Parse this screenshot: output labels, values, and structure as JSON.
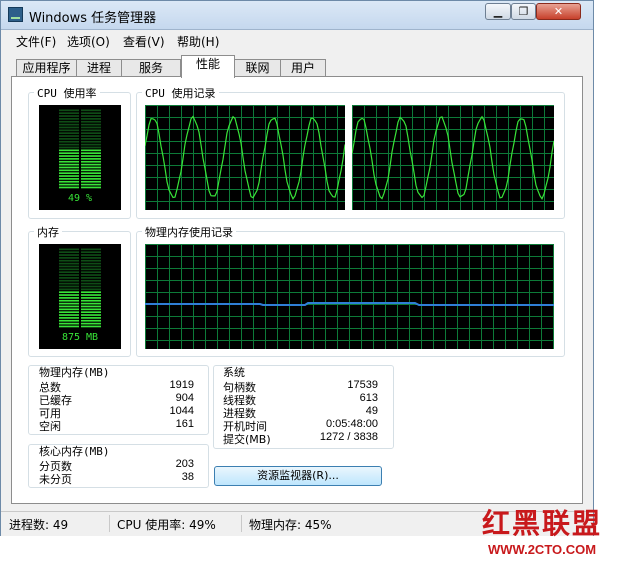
{
  "window": {
    "title": "Windows 任务管理器",
    "min_label": "▁",
    "max_label": "❐",
    "close_label": "✕",
    "icon": "task-manager-icon"
  },
  "menu": [
    {
      "label": "文件(F)"
    },
    {
      "label": "选项(O)"
    },
    {
      "label": "查看(V)"
    },
    {
      "label": "帮助(H)"
    }
  ],
  "tabs": [
    {
      "label": "应用程序"
    },
    {
      "label": "进程"
    },
    {
      "label": "服务"
    },
    {
      "label": "性能",
      "active": true
    },
    {
      "label": "联网"
    },
    {
      "label": "用户"
    }
  ],
  "performance": {
    "cpu_usage": {
      "title": "CPU 使用率",
      "value": "49 %",
      "fraction": 0.49
    },
    "cpu_history": {
      "title": "CPU 使用记录"
    },
    "memory": {
      "title": "内存",
      "value": "875 MB",
      "fraction": 0.45
    },
    "memory_history": {
      "title": "物理内存使用记录"
    },
    "physical_memory": {
      "title": "物理内存(MB)",
      "rows": [
        {
          "label": "总数",
          "value": "1919"
        },
        {
          "label": "已缓存",
          "value": "904"
        },
        {
          "label": "可用",
          "value": "1044"
        },
        {
          "label": "空闲",
          "value": "161"
        }
      ]
    },
    "kernel_memory": {
      "title": "核心内存(MB)",
      "rows": [
        {
          "label": "分页数",
          "value": "203"
        },
        {
          "label": "未分页",
          "value": "38"
        }
      ]
    },
    "system": {
      "title": "系统",
      "rows": [
        {
          "label": "句柄数",
          "value": "17539"
        },
        {
          "label": "线程数",
          "value": "613"
        },
        {
          "label": "进程数",
          "value": "49"
        },
        {
          "label": "开机时间",
          "value": "0:05:48:00"
        },
        {
          "label": "提交(MB)",
          "value": "1272 / 3838"
        }
      ]
    },
    "resource_monitor_button": "资源监视器(R)..."
  },
  "statusbar": {
    "processes": "进程数: 49",
    "cpu": "CPU 使用率: 49%",
    "memory": "物理内存: 45%"
  },
  "watermark": {
    "logo": "红黑联盟",
    "url": "WWW.2CTO.COM"
  },
  "colors": {
    "meter_green": "#38e438",
    "grid_green": "#0d7a38",
    "line_blue": "#2f7fd6"
  }
}
